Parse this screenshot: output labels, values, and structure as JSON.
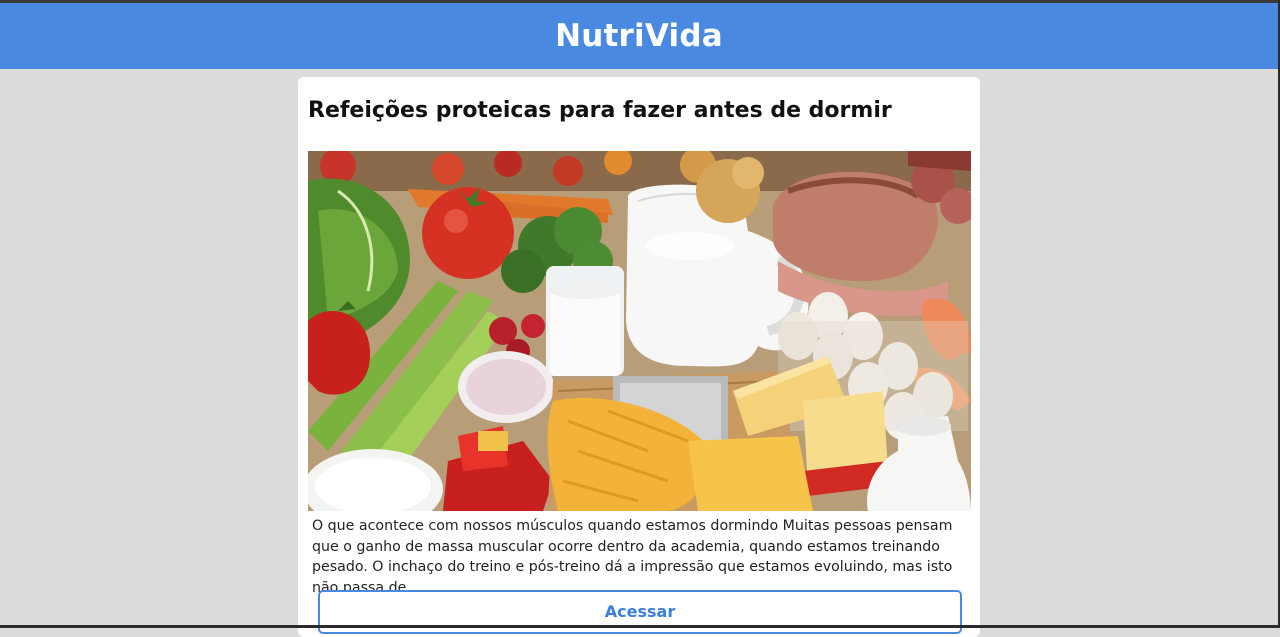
{
  "app": {
    "brand": "NutriVida"
  },
  "article": {
    "title": "Refeições proteicas para fazer antes de dormir",
    "image_alt": "Alimentos ricos em proteína: leite, ovos, queijos, presunto, vegetais",
    "excerpt": "O que acontece com nossos músculos quando estamos dormindo Muitas pessoas pensam que o ganho de massa muscular ocorre dentro da academia, quando estamos treinando pesado. O inchaço do treino e pós-treino dá a impressão que estamos evoluindo, mas isto não passa de...",
    "button_label": "Acessar"
  },
  "colors": {
    "header": "#4a89e2",
    "button_border": "#4a89e2",
    "button_text": "#3c7fdb",
    "page_background": "#dcdcdc"
  }
}
